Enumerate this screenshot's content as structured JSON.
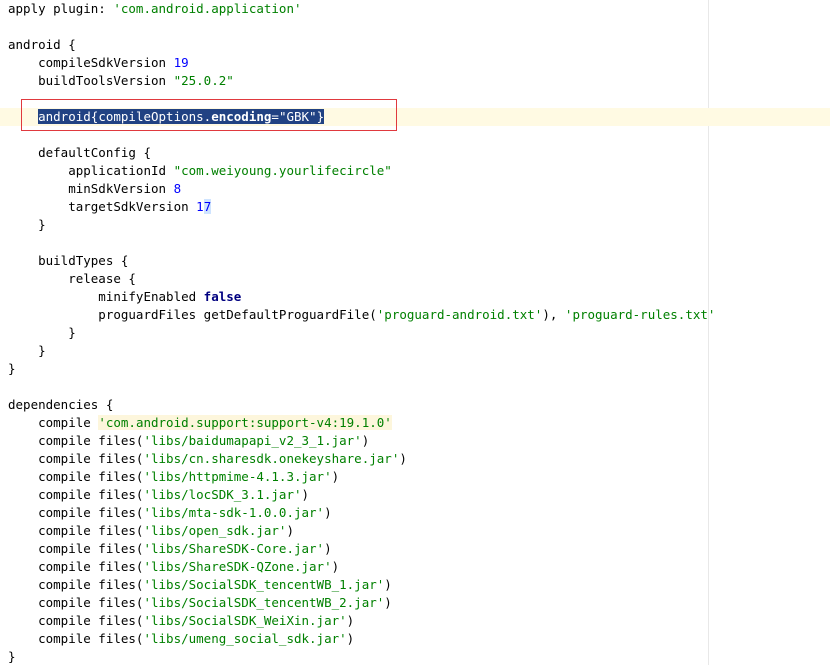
{
  "editor": {
    "lines": [
      [
        {
          "t": "apply plugin: ",
          "c": "plain"
        },
        {
          "t": "'com.android.application'",
          "c": "str"
        }
      ],
      [],
      [
        {
          "t": "android {",
          "c": "plain"
        }
      ],
      [
        {
          "t": "    compileSdkVersion ",
          "c": "plain"
        },
        {
          "t": "19",
          "c": "num"
        }
      ],
      [
        {
          "t": "    buildToolsVersion ",
          "c": "plain"
        },
        {
          "t": "\"25.0.2\"",
          "c": "str"
        }
      ],
      [],
      [
        {
          "t": "    ",
          "c": "plain"
        },
        {
          "t": "android{compileOptions.",
          "c": "sel"
        },
        {
          "t": "encoding",
          "c": "selkw"
        },
        {
          "t": "=",
          "c": "sel"
        },
        {
          "t": "\"GBK\"",
          "c": "selstr"
        },
        {
          "t": "}",
          "c": "sel"
        }
      ],
      [],
      [
        {
          "t": "    defaultConfig {",
          "c": "plain"
        }
      ],
      [
        {
          "t": "        applicationId ",
          "c": "plain"
        },
        {
          "t": "\"com.weiyoung.yourlifecircle\"",
          "c": "str"
        }
      ],
      [
        {
          "t": "        minSdkVersion ",
          "c": "plain"
        },
        {
          "t": "8",
          "c": "num"
        }
      ],
      [
        {
          "t": "        targetSdkVersion ",
          "c": "plain"
        },
        {
          "t": "1",
          "c": "num"
        },
        {
          "t": "7",
          "c": "numhl"
        }
      ],
      [
        {
          "t": "    }",
          "c": "plain"
        }
      ],
      [],
      [
        {
          "t": "    buildTypes {",
          "c": "plain"
        }
      ],
      [
        {
          "t": "        release {",
          "c": "plain"
        }
      ],
      [
        {
          "t": "            minifyEnabled ",
          "c": "plain"
        },
        {
          "t": "false",
          "c": "kw"
        }
      ],
      [
        {
          "t": "            proguardFiles getDefaultProguardFile(",
          "c": "plain"
        },
        {
          "t": "'proguard-android.txt'",
          "c": "str"
        },
        {
          "t": "), ",
          "c": "plain"
        },
        {
          "t": "'proguard-rules.txt'",
          "c": "str"
        }
      ],
      [
        {
          "t": "        }",
          "c": "plain"
        }
      ],
      [
        {
          "t": "    }",
          "c": "plain"
        }
      ],
      [
        {
          "t": "}",
          "c": "plain"
        }
      ],
      [],
      [
        {
          "t": "dependencies {",
          "c": "plain"
        }
      ],
      [
        {
          "t": "    compile ",
          "c": "plain"
        },
        {
          "t": "'com.android.support:support-v4:19.1.0'",
          "c": "strhl"
        }
      ],
      [
        {
          "t": "    compile files(",
          "c": "plain"
        },
        {
          "t": "'libs/baidumapapi_v2_3_1.jar'",
          "c": "str"
        },
        {
          "t": ")",
          "c": "plain"
        }
      ],
      [
        {
          "t": "    compile files(",
          "c": "plain"
        },
        {
          "t": "'libs/cn.sharesdk.onekeyshare.jar'",
          "c": "str"
        },
        {
          "t": ")",
          "c": "plain"
        }
      ],
      [
        {
          "t": "    compile files(",
          "c": "plain"
        },
        {
          "t": "'libs/httpmime-4.1.3.jar'",
          "c": "str"
        },
        {
          "t": ")",
          "c": "plain"
        }
      ],
      [
        {
          "t": "    compile files(",
          "c": "plain"
        },
        {
          "t": "'libs/locSDK_3.1.jar'",
          "c": "str"
        },
        {
          "t": ")",
          "c": "plain"
        }
      ],
      [
        {
          "t": "    compile files(",
          "c": "plain"
        },
        {
          "t": "'libs/mta-sdk-1.0.0.jar'",
          "c": "str"
        },
        {
          "t": ")",
          "c": "plain"
        }
      ],
      [
        {
          "t": "    compile files(",
          "c": "plain"
        },
        {
          "t": "'libs/open_sdk.jar'",
          "c": "str"
        },
        {
          "t": ")",
          "c": "plain"
        }
      ],
      [
        {
          "t": "    compile files(",
          "c": "plain"
        },
        {
          "t": "'libs/ShareSDK-Core.jar'",
          "c": "str"
        },
        {
          "t": ")",
          "c": "plain"
        }
      ],
      [
        {
          "t": "    compile files(",
          "c": "plain"
        },
        {
          "t": "'libs/ShareSDK-QZone.jar'",
          "c": "str"
        },
        {
          "t": ")",
          "c": "plain"
        }
      ],
      [
        {
          "t": "    compile files(",
          "c": "plain"
        },
        {
          "t": "'libs/SocialSDK_tencentWB_1.jar'",
          "c": "str"
        },
        {
          "t": ")",
          "c": "plain"
        }
      ],
      [
        {
          "t": "    compile files(",
          "c": "plain"
        },
        {
          "t": "'libs/SocialSDK_tencentWB_2.jar'",
          "c": "str"
        },
        {
          "t": ")",
          "c": "plain"
        }
      ],
      [
        {
          "t": "    compile files(",
          "c": "plain"
        },
        {
          "t": "'libs/SocialSDK_WeiXin.jar'",
          "c": "str"
        },
        {
          "t": ")",
          "c": "plain"
        }
      ],
      [
        {
          "t": "    compile files(",
          "c": "plain"
        },
        {
          "t": "'libs/umeng_social_sdk.jar'",
          "c": "str"
        },
        {
          "t": ")",
          "c": "plain"
        }
      ],
      [
        {
          "t": "}",
          "c": "plain"
        }
      ]
    ],
    "caret_line_index": 6,
    "colors": {
      "string": "#008000",
      "number": "#0000ff",
      "keyword": "#000080",
      "selection": "#214283",
      "caret_line": "#fffae3",
      "annotation_box": "#e0393e"
    }
  }
}
